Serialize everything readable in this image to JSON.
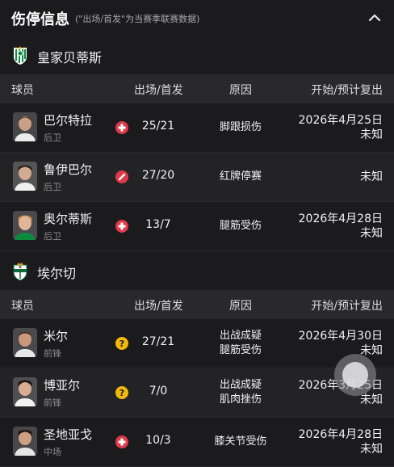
{
  "header": {
    "title": "伤停信息",
    "subtitle": "(\"出场/首发\"为当赛季联赛数据)"
  },
  "table_headers": {
    "player": "球员",
    "apps": "出场/首发",
    "reason": "原因",
    "dates": "开始/预计复出"
  },
  "teams": [
    {
      "name": "皇家贝蒂斯",
      "colors": {
        "primary": "#0a8a3c"
      },
      "players": [
        {
          "name": "巴尔特拉",
          "position": "后卫",
          "status_icon": "medical-cross-icon",
          "apps": "25/21",
          "reason": [
            "脚跟损伤"
          ],
          "start": "2026年4月25日",
          "return": "未知"
        },
        {
          "name": "鲁伊巴尔",
          "position": "后卫",
          "status_icon": "red-card-icon",
          "apps": "27/20",
          "reason": [
            "红牌停赛"
          ],
          "start": "",
          "return": "未知"
        },
        {
          "name": "奥尔蒂斯",
          "position": "后卫",
          "status_icon": "medical-cross-icon",
          "apps": "13/7",
          "reason": [
            "腿筋受伤"
          ],
          "start": "2026年4月28日",
          "return": "未知"
        }
      ]
    },
    {
      "name": "埃尔切",
      "colors": {
        "primary": "#0a6a3a"
      },
      "players": [
        {
          "name": "米尔",
          "position": "前锋",
          "status_icon": "question-icon",
          "apps": "27/21",
          "reason": [
            "出战成疑",
            "腿筋受伤"
          ],
          "start": "2026年4月30日",
          "return": "未知"
        },
        {
          "name": "博亚尔",
          "position": "前锋",
          "status_icon": "question-icon",
          "apps": "7/0",
          "reason": [
            "出战成疑",
            "肌肉挫伤"
          ],
          "start": "2026年3月25日",
          "return": "未知"
        },
        {
          "name": "圣地亚戈",
          "position": "中场",
          "status_icon": "medical-cross-icon",
          "apps": "10/3",
          "reason": [
            "膝关节受伤"
          ],
          "start": "2026年4月28日",
          "return": "未知"
        }
      ]
    }
  ],
  "colors": {
    "background": "#1b1b1d",
    "header_row": "#29292c",
    "injury_red": "#e03a4a",
    "doubtful_yellow": "#f0b90b"
  }
}
